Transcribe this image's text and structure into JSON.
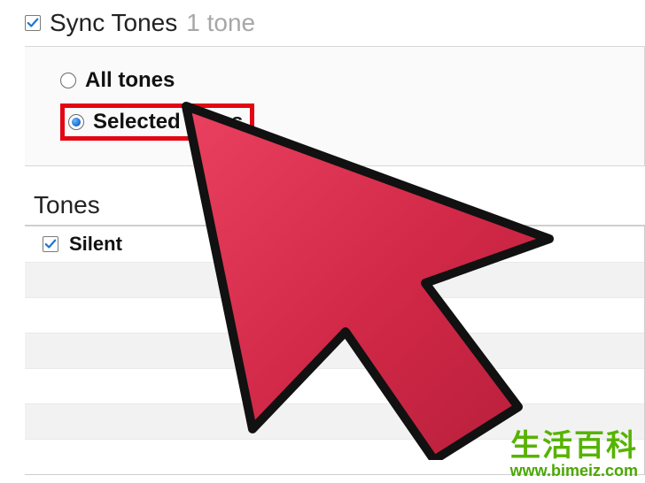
{
  "header": {
    "sync_checked": true,
    "title": "Sync Tones",
    "count_text": "1 tone"
  },
  "options": {
    "all_label": "All tones",
    "selected_label": "Selected tones",
    "choice": "selected"
  },
  "tones_section": {
    "title": "Tones",
    "items": [
      {
        "label": "Silent",
        "checked": true
      }
    ]
  },
  "watermark": {
    "cn": "生活百科",
    "url": "www.bimeiz.com"
  },
  "colors": {
    "highlight": "#e30613",
    "cursor_fill": "#d9294a",
    "accent_check": "#1e75d3"
  }
}
